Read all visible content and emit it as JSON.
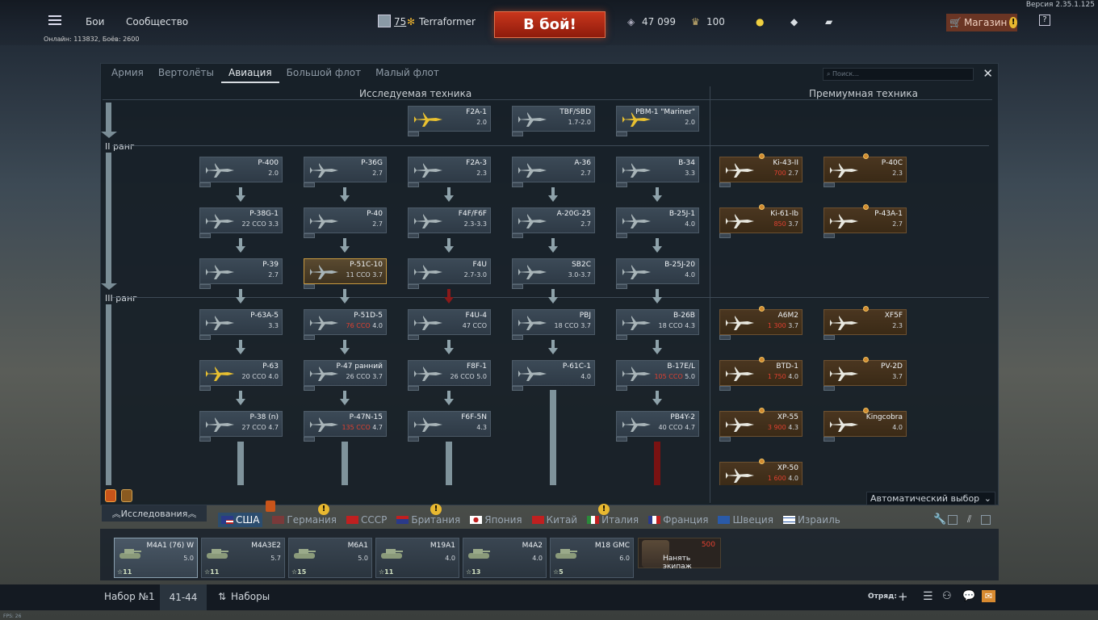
{
  "version": "Версия 2.35.1.125",
  "topbar": {
    "battles": "Бои",
    "community": "Сообщество",
    "rank": "75",
    "player": "Terraformer",
    "battle_btn": "В бой!",
    "silver": "47 099",
    "golden": "100",
    "shop": "Магазин",
    "online": "Онлайн: 113832, Боёв: 2600"
  },
  "tabs": [
    "Армия",
    "Вертолёты",
    "Авиация",
    "Большой флот",
    "Малый флот"
  ],
  "active_tab": "Авиация",
  "search_placeholder": "Поиск...",
  "sections": {
    "research": "Исследуемая техника",
    "premium": "Премиумная техника"
  },
  "ranks": {
    "r2": "II ранг",
    "r3": "III ранг"
  },
  "tree": [
    {
      "name": "F2A-1",
      "br": "2.0"
    },
    {
      "name": "TBF/SBD",
      "br": "1.7-2.0"
    },
    {
      "name": "PBM-1 \"Mariner\"",
      "br": "2.0"
    },
    {
      "name": "P-400",
      "br": "2.0"
    },
    {
      "name": "P-36G",
      "br": "2.7"
    },
    {
      "name": "F2A-3",
      "br": "2.3"
    },
    {
      "name": "A-36",
      "br": "2.7"
    },
    {
      "name": "B-34",
      "br": "3.3"
    },
    {
      "name": "P-38G-1",
      "br": "3.3",
      "cost": "22 CCO"
    },
    {
      "name": "P-40",
      "br": "2.7"
    },
    {
      "name": "F4F/F6F",
      "br": "2.3-3.3"
    },
    {
      "name": "A-20G-25",
      "br": "2.7"
    },
    {
      "name": "B-25J-1",
      "br": "4.0"
    },
    {
      "name": "P-39",
      "br": "2.7"
    },
    {
      "name": "P-51C-10",
      "br": "3.7",
      "cost": "11 CCO"
    },
    {
      "name": "F4U",
      "br": "2.7-3.0"
    },
    {
      "name": "SB2C",
      "br": "3.0-3.7"
    },
    {
      "name": "B-25J-20",
      "br": "4.0"
    },
    {
      "name": "P-63A-5",
      "br": "3.3"
    },
    {
      "name": "P-51D-5",
      "br": "4.0",
      "cost": "76 CCO"
    },
    {
      "name": "F4U-4",
      "br": "",
      "cost": "47 CCO"
    },
    {
      "name": "PBJ",
      "br": "3.7",
      "cost": "18 CCO"
    },
    {
      "name": "B-26B",
      "br": "4.3",
      "cost": "18 CCO"
    },
    {
      "name": "P-63",
      "br": "4.0",
      "cost": "20 CCO"
    },
    {
      "name": "P-47 ранний",
      "br": "3.7",
      "cost": "26 CCO"
    },
    {
      "name": "F8F-1",
      "br": "5.0",
      "cost": "26 CCO"
    },
    {
      "name": "P-61C-1",
      "br": "4.0"
    },
    {
      "name": "B-17E/L",
      "br": "5.0",
      "cost": "105 CCO"
    },
    {
      "name": "P-38 (n)",
      "br": "4.7",
      "cost": "27 CCO"
    },
    {
      "name": "P-47N-15",
      "br": "4.7",
      "cost": "135 CCO"
    },
    {
      "name": "F6F-5N",
      "br": "4.3"
    },
    {
      "name": "PB4Y-2",
      "br": "4.7",
      "cost": "40 CCO"
    }
  ],
  "premium": [
    {
      "name": "Ki-43-II",
      "br": "2.7",
      "cost": "700"
    },
    {
      "name": "P-40C",
      "br": "2.3"
    },
    {
      "name": "Ki-61-Ib",
      "br": "3.7",
      "cost": "850"
    },
    {
      "name": "P-43A-1",
      "br": "2.7"
    },
    {
      "name": "A6M2",
      "br": "3.7",
      "cost": "1 300"
    },
    {
      "name": "XF5F",
      "br": "2.3"
    },
    {
      "name": "BTD-1",
      "br": "4.0",
      "cost": "1 750"
    },
    {
      "name": "PV-2D",
      "br": "3.7"
    },
    {
      "name": "XP-55",
      "br": "4.3",
      "cost": "3 900"
    },
    {
      "name": "Kingcobra",
      "br": "4.0"
    },
    {
      "name": "XP-50",
      "br": "4.0",
      "cost": "1 600"
    }
  ],
  "auto_select": "Автоматический выбор",
  "research_label": "Исследования",
  "nations": [
    "США",
    "Германия",
    "СССР",
    "Британия",
    "Япония",
    "Китай",
    "Италия",
    "Франция",
    "Швеция",
    "Израиль"
  ],
  "crew": [
    {
      "name": "M4A1 (76) W",
      "br": "5.0",
      "crew": "11"
    },
    {
      "name": "M4A3E2",
      "br": "5.7",
      "crew": "11"
    },
    {
      "name": "M6A1",
      "br": "5.0",
      "crew": "15"
    },
    {
      "name": "M19A1",
      "br": "4.0",
      "crew": "11"
    },
    {
      "name": "M4A2",
      "br": "4.0",
      "crew": "13"
    },
    {
      "name": "M18 GMC",
      "br": "6.0",
      "crew": "5"
    }
  ],
  "hire": {
    "cost": "500",
    "label": "Нанять экипаж"
  },
  "bottom": {
    "preset": "Набор №1",
    "range": "41-44",
    "presets": "Наборы",
    "squad": "Отряд:"
  },
  "fps": "FPS: 26",
  "colors": {
    "accent": "#c9361c",
    "premium": "#3a2a16"
  }
}
